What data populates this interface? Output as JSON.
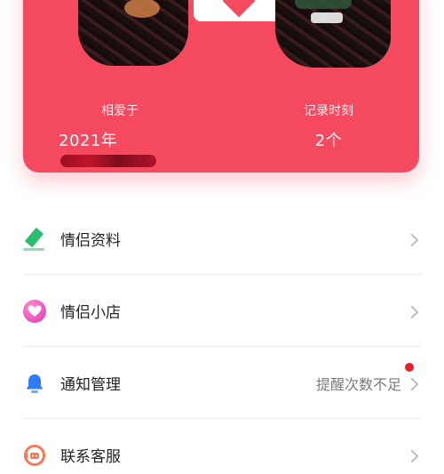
{
  "card": {
    "together_label": "相爱于",
    "together_date_prefix": "2021年",
    "records_label": "记录时刻",
    "records_value": "2个",
    "accent_color": "#f5495f"
  },
  "menu": {
    "items": [
      {
        "label": "情侣资料",
        "icon": "pencil-icon",
        "status": ""
      },
      {
        "label": "情侣小店",
        "icon": "heart-icon",
        "status": ""
      },
      {
        "label": "通知管理",
        "icon": "bell-icon",
        "status": "提醒次数不足"
      },
      {
        "label": "联系客服",
        "icon": "customer-service-icon",
        "status": ""
      }
    ]
  },
  "colors": {
    "chevron": "#bdbdbd",
    "status_dot": "#e8202a",
    "divider": "#ececec"
  }
}
